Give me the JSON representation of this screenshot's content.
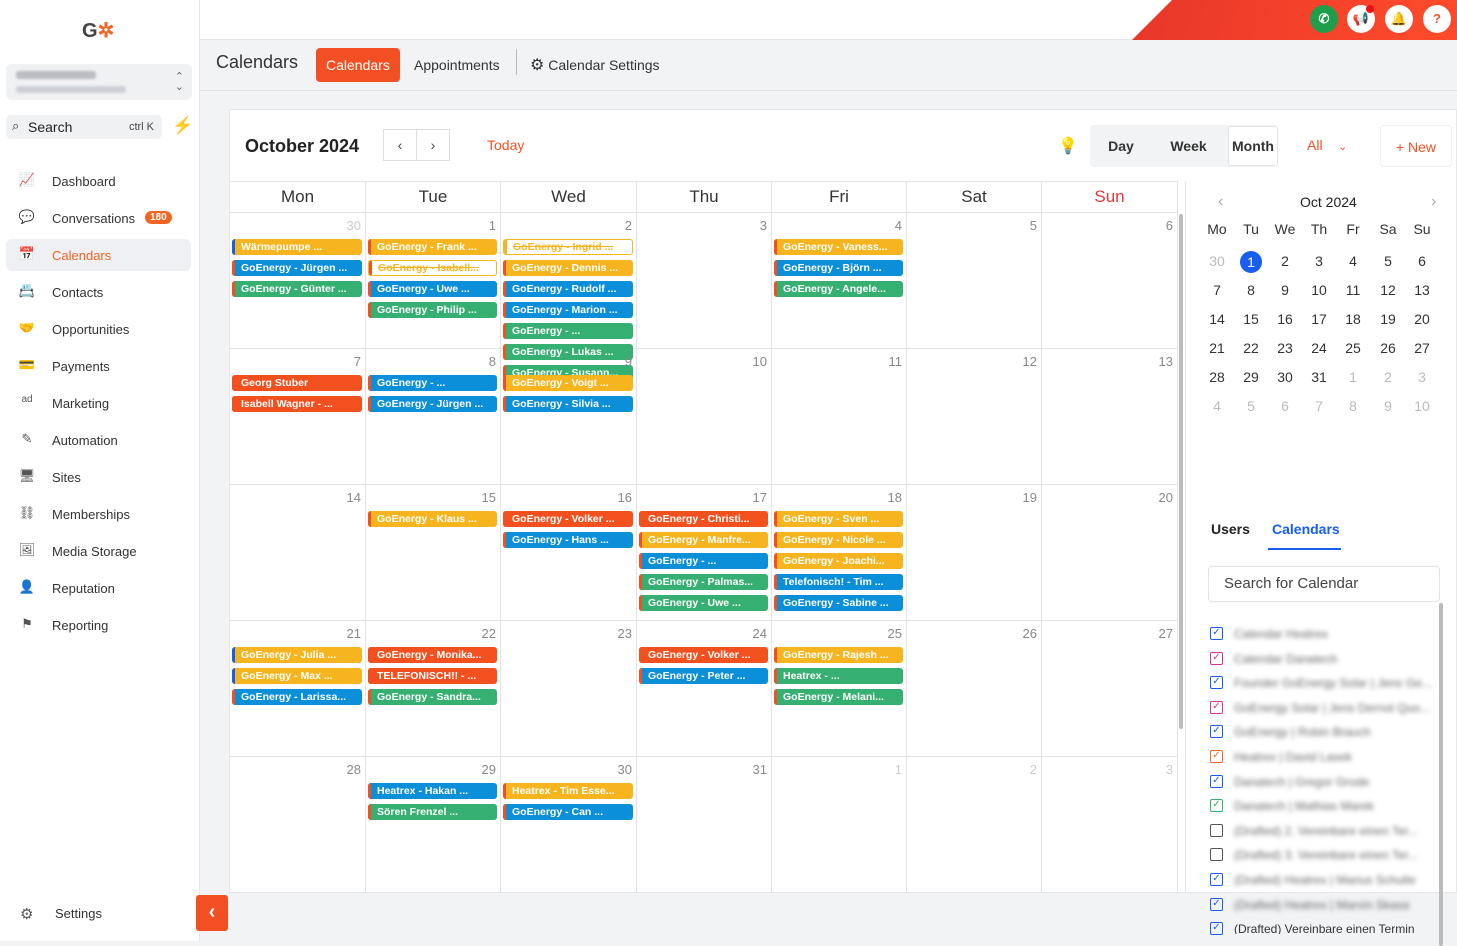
{
  "sidebar": {
    "logo": "G",
    "account": {
      "name": "GoEnergy Pro",
      "location": "Duisburg, Nordrhei..."
    },
    "search": {
      "label": "Search",
      "shortcut": "ctrl K"
    },
    "items": [
      {
        "label": "Dashboard",
        "icon": "chart-line-icon"
      },
      {
        "label": "Conversations",
        "icon": "chat-icon",
        "badge": "180"
      },
      {
        "label": "Calendars",
        "icon": "calendar-icon",
        "active": true
      },
      {
        "label": "Contacts",
        "icon": "contacts-icon"
      },
      {
        "label": "Opportunities",
        "icon": "handshake-icon"
      },
      {
        "label": "Payments",
        "icon": "credit-card-icon"
      },
      {
        "label": "Marketing",
        "icon": "ad-icon"
      },
      {
        "label": "Automation",
        "icon": "pencil-icon"
      },
      {
        "label": "Sites",
        "icon": "monitor-icon"
      },
      {
        "label": "Memberships",
        "icon": "sitemap-icon"
      },
      {
        "label": "Media Storage",
        "icon": "image-icon"
      },
      {
        "label": "Reputation",
        "icon": "user-icon"
      },
      {
        "label": "Reporting",
        "icon": "flag-icon"
      }
    ],
    "settings": "Settings"
  },
  "header": {
    "page_title": "Calendars",
    "tabs": [
      "Calendars",
      "Appointments",
      "Calendar Settings"
    ],
    "help": "?"
  },
  "toolbar": {
    "month_title": "October 2024",
    "today": "Today",
    "views": [
      "Day",
      "Week",
      "Month"
    ],
    "filter": "All",
    "new": "New"
  },
  "weekdays": [
    "Mon",
    "Tue",
    "Wed",
    "Thu",
    "Fri",
    "Sat",
    "Sun"
  ],
  "colors": {
    "accent": "#f25022",
    "yellow": "#f6b51f",
    "blue": "#0b8fd8",
    "green": "#36b072",
    "red": "#f3501f",
    "selected": "#155eef"
  },
  "weeks": [
    {
      "days": [
        {
          "n": "30",
          "out": true,
          "events": [
            {
              "t": "Wärmepumpe ...",
              "c": "y",
              "bar": "#155eef"
            },
            {
              "t": "GoEnergy - Jürgen ...",
              "c": "b",
              "bar": "#f3501f"
            },
            {
              "t": "GoEnergy - Günter ...",
              "c": "g",
              "bar": "#f3501f"
            }
          ]
        },
        {
          "n": "1",
          "events": [
            {
              "t": "GoEnergy - Frank ...",
              "c": "y",
              "bar": "#f3501f"
            },
            {
              "t": "GoEnergy - Isabell...",
              "c": "strike",
              "bar": "#f3501f"
            },
            {
              "t": "GoEnergy - Uwe ...",
              "c": "b",
              "bar": "#f3501f"
            },
            {
              "t": "GoEnergy - Philip ...",
              "c": "g",
              "bar": "#f3501f"
            }
          ]
        },
        {
          "n": "2",
          "events": [
            {
              "t": "GoEnergy - Ingrid ...",
              "c": "strike",
              "bar": "#f6b51f"
            },
            {
              "t": "GoEnergy - Dennis ...",
              "c": "y",
              "bar": "#f3501f"
            },
            {
              "t": "GoEnergy - Rudolf ...",
              "c": "b",
              "bar": "#f3501f"
            },
            {
              "t": "GoEnergy - Marion ...",
              "c": "b",
              "bar": "#f3501f"
            },
            {
              "t": "GoEnergy - ...",
              "c": "g",
              "bar": "#f3501f"
            },
            {
              "t": "GoEnergy - Lukas ...",
              "c": "g",
              "bar": "#f3501f"
            },
            {
              "t": "GoEnergy - Susann...",
              "c": "g",
              "bar": "#f3501f"
            }
          ]
        },
        {
          "n": "3",
          "events": []
        },
        {
          "n": "4",
          "events": [
            {
              "t": "GoEnergy - Vaness...",
              "c": "y",
              "bar": "#f3501f"
            },
            {
              "t": "GoEnergy - Björn ...",
              "c": "b",
              "bar": "#f3501f"
            },
            {
              "t": "GoEnergy - Angele...",
              "c": "g",
              "bar": "#f3501f"
            }
          ]
        },
        {
          "n": "5",
          "events": []
        },
        {
          "n": "6",
          "events": []
        }
      ]
    },
    {
      "days": [
        {
          "n": "7",
          "events": [
            {
              "t": "Georg Stuber",
              "c": "r",
              "bar": "#f3501f"
            },
            {
              "t": "Isabell Wagner - ...",
              "c": "r",
              "bar": "#f3501f"
            }
          ]
        },
        {
          "n": "8",
          "events": [
            {
              "t": "GoEnergy - ...",
              "c": "b",
              "bar": "#f3501f"
            },
            {
              "t": "GoEnergy - Jürgen ...",
              "c": "b",
              "bar": "#f3501f"
            }
          ]
        },
        {
          "n": "9",
          "events": [
            {
              "t": "GoEnergy - Voigt ...",
              "c": "y",
              "bar": "#f3501f"
            },
            {
              "t": "GoEnergy - Silvia ...",
              "c": "b",
              "bar": "#f3501f"
            }
          ]
        },
        {
          "n": "10",
          "events": []
        },
        {
          "n": "11",
          "events": []
        },
        {
          "n": "12",
          "events": []
        },
        {
          "n": "13",
          "events": []
        }
      ]
    },
    {
      "days": [
        {
          "n": "14",
          "events": []
        },
        {
          "n": "15",
          "events": [
            {
              "t": "GoEnergy - Klaus ...",
              "c": "y",
              "bar": "#f3501f"
            }
          ]
        },
        {
          "n": "16",
          "events": [
            {
              "t": "GoEnergy - Volker ...",
              "c": "r",
              "bar": "#f3501f"
            },
            {
              "t": "GoEnergy - Hans ...",
              "c": "b",
              "bar": "#f3501f"
            }
          ]
        },
        {
          "n": "17",
          "events": [
            {
              "t": "GoEnergy - Christi...",
              "c": "r",
              "bar": "#f3501f"
            },
            {
              "t": "GoEnergy - Manfre...",
              "c": "y",
              "bar": "#f3501f"
            },
            {
              "t": "GoEnergy - ...",
              "c": "b",
              "bar": "#f3501f"
            },
            {
              "t": "GoEnergy - Palmas...",
              "c": "g",
              "bar": "#f3501f"
            },
            {
              "t": "GoEnergy - Uwe ...",
              "c": "g",
              "bar": "#f3501f"
            }
          ]
        },
        {
          "n": "18",
          "events": [
            {
              "t": "GoEnergy - Sven ...",
              "c": "y",
              "bar": "#f3501f"
            },
            {
              "t": "GoEnergy - Nicole ...",
              "c": "y",
              "bar": "#f3501f"
            },
            {
              "t": "GoEnergy - Joachi...",
              "c": "y",
              "bar": "#f3501f"
            },
            {
              "t": "Telefonisch! - Tim ...",
              "c": "b",
              "bar": "#f3501f"
            },
            {
              "t": "GoEnergy - Sabine ...",
              "c": "b",
              "bar": "#f3501f"
            }
          ]
        },
        {
          "n": "19",
          "events": []
        },
        {
          "n": "20",
          "events": []
        }
      ]
    },
    {
      "days": [
        {
          "n": "21",
          "events": [
            {
              "t": "GoEnergy - Julia ...",
              "c": "y",
              "bar": "#155eef"
            },
            {
              "t": "GoEnergy - Max ...",
              "c": "y",
              "bar": "#155eef"
            },
            {
              "t": "GoEnergy - Larissa...",
              "c": "b",
              "bar": "#f3501f"
            }
          ]
        },
        {
          "n": "22",
          "events": [
            {
              "t": "GoEnergy - Monika...",
              "c": "r",
              "bar": "#f3501f"
            },
            {
              "t": "TELEFONISCH!! - ...",
              "c": "r",
              "bar": "#f3501f"
            },
            {
              "t": "GoEnergy - Sandra...",
              "c": "g",
              "bar": "#f3501f"
            }
          ]
        },
        {
          "n": "23",
          "events": []
        },
        {
          "n": "24",
          "events": [
            {
              "t": "GoEnergy - Volker ...",
              "c": "r",
              "bar": "#f3501f"
            },
            {
              "t": "GoEnergy - Peter ...",
              "c": "b",
              "bar": "#f3501f"
            }
          ]
        },
        {
          "n": "25",
          "events": [
            {
              "t": "GoEnergy - Rajesh ...",
              "c": "y",
              "bar": "#f3501f"
            },
            {
              "t": "Heatrex - ...",
              "c": "g",
              "bar": "#f3501f"
            },
            {
              "t": "GoEnergy - Melani...",
              "c": "g",
              "bar": "#f3501f"
            }
          ]
        },
        {
          "n": "26",
          "events": []
        },
        {
          "n": "27",
          "events": []
        }
      ]
    },
    {
      "days": [
        {
          "n": "28",
          "events": []
        },
        {
          "n": "29",
          "events": [
            {
              "t": "Heatrex - Hakan ...",
              "c": "b",
              "bar": "#f3501f"
            },
            {
              "t": "Sören Frenzel ...",
              "c": "g",
              "bar": "#f3501f"
            }
          ]
        },
        {
          "n": "30",
          "events": [
            {
              "t": "Heatrex - Tim Esse...",
              "c": "y",
              "bar": "#f3501f"
            },
            {
              "t": "GoEnergy - Can ...",
              "c": "b",
              "bar": "#f3501f"
            }
          ]
        },
        {
          "n": "31",
          "events": []
        },
        {
          "n": "1",
          "out": true,
          "events": []
        },
        {
          "n": "2",
          "out": true,
          "events": []
        },
        {
          "n": "3",
          "out": true,
          "events": []
        }
      ]
    }
  ],
  "mini": {
    "title": "Oct 2024",
    "headers": [
      "Mo",
      "Tu",
      "We",
      "Th",
      "Fr",
      "Sa",
      "Su"
    ],
    "rows": [
      [
        "30",
        "1",
        "2",
        "3",
        "4",
        "5",
        "6"
      ],
      [
        "7",
        "8",
        "9",
        "10",
        "11",
        "12",
        "13"
      ],
      [
        "14",
        "15",
        "16",
        "17",
        "18",
        "19",
        "20"
      ],
      [
        "21",
        "22",
        "23",
        "24",
        "25",
        "26",
        "27"
      ],
      [
        "28",
        "29",
        "30",
        "31",
        "1",
        "2",
        "3"
      ],
      [
        "4",
        "5",
        "6",
        "7",
        "8",
        "9",
        "10"
      ]
    ]
  },
  "side_tabs": [
    "Users",
    "Calendars"
  ],
  "cal_search_placeholder": "Search for Calendar",
  "calendars": [
    {
      "label": "Calendar Heatrex",
      "color": "#155eef",
      "checked": true
    },
    {
      "label": "Calendar Danatech",
      "color": "#d9338b",
      "checked": true
    },
    {
      "label": "Founder GoEnergy Solar | Jens Ge...",
      "color": "#155eef",
      "checked": true
    },
    {
      "label": "GoEnergy Solar | Jens Dernot Quo...",
      "color": "#d9338b",
      "checked": true
    },
    {
      "label": "GoEnergy | Robin Brauch",
      "color": "#155eef",
      "checked": true
    },
    {
      "label": "Heatrex | David Lasek",
      "color": "#f26522",
      "checked": true
    },
    {
      "label": "Danatech | Gregor Grode",
      "color": "#155eef",
      "checked": true
    },
    {
      "label": "Danatech | Mathias Marek",
      "color": "#36b072",
      "checked": true
    },
    {
      "label": "(Drafted) 2. Vereinbare einen Ter...",
      "color": "#555",
      "checked": false
    },
    {
      "label": "(Drafted) 3. Vereinbare einen Ter...",
      "color": "#555",
      "checked": false
    },
    {
      "label": "(Drafted) Heatrex | Marius Schulte",
      "color": "#155eef",
      "checked": true
    },
    {
      "label": "(Drafted) Heatrex | Marvin Skasa",
      "color": "#155eef",
      "checked": true
    },
    {
      "label": "(Drafted) Vereinbare einen Termin",
      "color": "#155eef",
      "checked": true
    }
  ]
}
